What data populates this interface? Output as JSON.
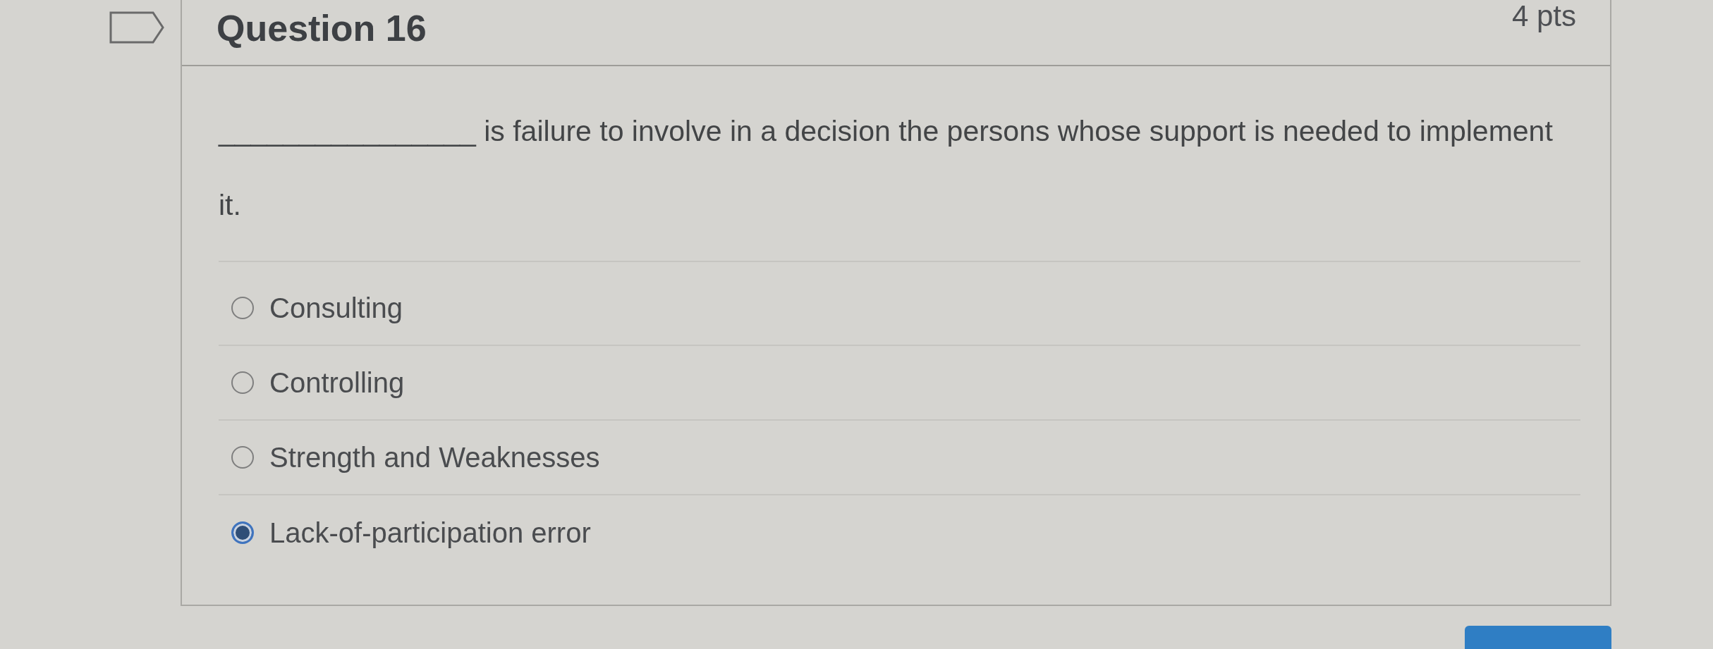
{
  "question": {
    "title": "Question 16",
    "points": "4 pts",
    "text": "________________ is failure to involve in a decision the persons whose support is needed to implement it."
  },
  "answers": [
    {
      "label": "Consulting",
      "selected": false
    },
    {
      "label": "Controlling",
      "selected": false
    },
    {
      "label": "Strength and Weaknesses",
      "selected": false
    },
    {
      "label": "Lack-of-participation error",
      "selected": true
    }
  ]
}
